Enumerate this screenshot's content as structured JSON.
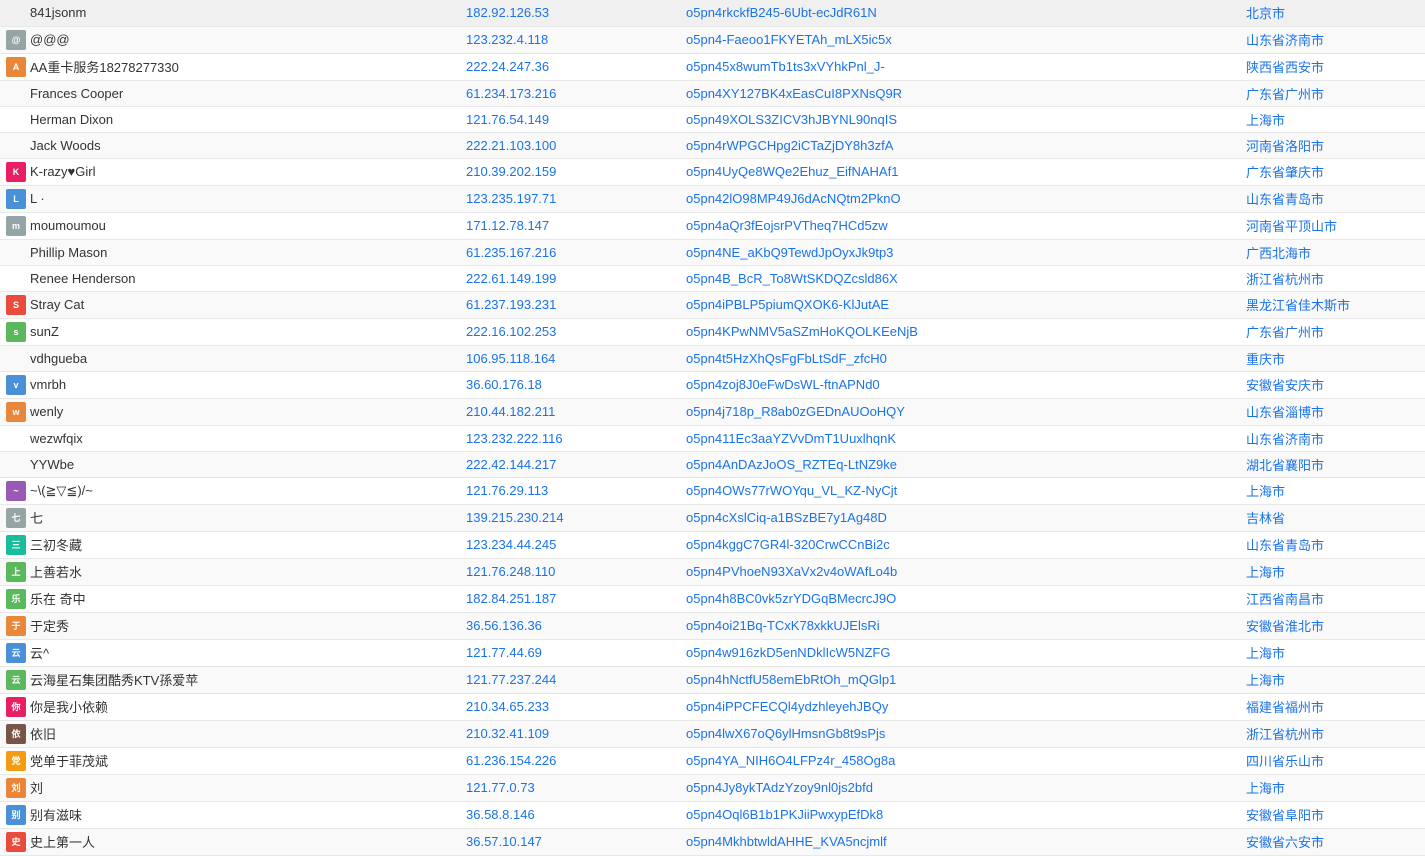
{
  "rows": [
    {
      "name": "841jsonm",
      "hasAvatar": false,
      "avatarColor": "",
      "nameStyle": "plain",
      "ip": "182.92.126.53",
      "id": "o5pn4rkckfB245-6Ubt-ecJdR61N",
      "location": "北京市"
    },
    {
      "name": "@@@",
      "hasAvatar": true,
      "avatarColor": "av-gray",
      "nameStyle": "plain",
      "ip": "123.232.4.118",
      "id": "o5pn4-Faeoo1FKYETAh_mLX5ic5x",
      "location": "山东省济南市"
    },
    {
      "name": "AA重卡服务18278277330",
      "hasAvatar": true,
      "avatarColor": "av-orange",
      "nameStyle": "plain",
      "ip": "222.24.247.36",
      "id": "o5pn45x8wumTb1ts3xVYhkPnl_J-",
      "location": "陕西省西安市"
    },
    {
      "name": "Frances Cooper",
      "hasAvatar": false,
      "avatarColor": "",
      "nameStyle": "plain",
      "ip": "61.234.173.216",
      "id": "o5pn4XY127BK4xEasCuI8PXNsQ9R",
      "location": "广东省广州市"
    },
    {
      "name": "Herman Dixon",
      "hasAvatar": false,
      "avatarColor": "",
      "nameStyle": "plain",
      "ip": "121.76.54.149",
      "id": "o5pn49XOLS3ZICV3hJBYNL90nqIS",
      "location": "上海市"
    },
    {
      "name": "Jack Woods",
      "hasAvatar": false,
      "avatarColor": "",
      "nameStyle": "plain",
      "ip": "222.21.103.100",
      "id": "o5pn4rWPGCHpg2iCTaZjDY8h3zfA",
      "location": "河南省洛阳市"
    },
    {
      "name": "K-razy♥Girl",
      "hasAvatar": true,
      "avatarColor": "av-pink",
      "nameStyle": "plain",
      "ip": "210.39.202.159",
      "id": "o5pn4UyQe8WQe2Ehuz_EifNAHAf1",
      "location": "广东省肇庆市"
    },
    {
      "name": "L ·",
      "hasAvatar": true,
      "avatarColor": "av-blue",
      "nameStyle": "plain",
      "ip": "123.235.197.71",
      "id": "o5pn42lO98MP49J6dAcNQtm2PknO",
      "location": "山东省青岛市"
    },
    {
      "name": "moumoumou",
      "hasAvatar": true,
      "avatarColor": "av-gray",
      "nameStyle": "plain",
      "ip": "171.12.78.147",
      "id": "o5pn4aQr3fEojsrPVTheq7HCd5zw",
      "location": "河南省平顶山市"
    },
    {
      "name": "Phillip Mason",
      "hasAvatar": false,
      "avatarColor": "",
      "nameStyle": "plain",
      "ip": "61.235.167.216",
      "id": "o5pn4NE_aKbQ9TewdJpOyxJk9tp3",
      "location": "广西北海市"
    },
    {
      "name": "Renee Henderson",
      "hasAvatar": false,
      "avatarColor": "",
      "nameStyle": "plain",
      "ip": "222.61.149.199",
      "id": "o5pn4B_BcR_To8WtSKDQZcsld86X",
      "location": "浙江省杭州市"
    },
    {
      "name": "Stray Cat",
      "hasAvatar": true,
      "avatarColor": "av-red",
      "nameStyle": "plain",
      "ip": "61.237.193.231",
      "id": "o5pn4iPBLP5piumQXOK6-KlJutAE",
      "location": "黑龙江省佳木斯市"
    },
    {
      "name": "sunZ",
      "hasAvatar": true,
      "avatarColor": "av-green",
      "nameStyle": "plain",
      "ip": "222.16.102.253",
      "id": "o5pn4KPwNMV5aSZmHoKQOLKEeNjB",
      "location": "广东省广州市"
    },
    {
      "name": "vdhgueba",
      "hasAvatar": false,
      "avatarColor": "",
      "nameStyle": "plain",
      "ip": "106.95.118.164",
      "id": "o5pn4t5HzXhQsFgFbLtSdF_zfcH0",
      "location": "重庆市"
    },
    {
      "name": "vmrbh",
      "hasAvatar": true,
      "avatarColor": "av-blue",
      "nameStyle": "plain",
      "ip": "36.60.176.18",
      "id": "o5pn4zoj8J0eFwDsWL-ftnAPNd0",
      "location": "安徽省安庆市"
    },
    {
      "name": "wenly",
      "hasAvatar": true,
      "avatarColor": "av-orange",
      "nameStyle": "plain",
      "ip": "210.44.182.211",
      "id": "o5pn4j718p_R8ab0zGEDnAUOoHQY",
      "location": "山东省淄博市"
    },
    {
      "name": "wezwfqix",
      "hasAvatar": false,
      "avatarColor": "",
      "nameStyle": "plain",
      "ip": "123.232.222.116",
      "id": "o5pn411Ec3aaYZVvDmT1UuxlhqnK",
      "location": "山东省济南市"
    },
    {
      "name": "YYWbe",
      "hasAvatar": false,
      "avatarColor": "",
      "nameStyle": "plain",
      "ip": "222.42.144.217",
      "id": "o5pn4AnDAzJoOS_RZTEq-LtNZ9ke",
      "location": "湖北省襄阳市"
    },
    {
      "name": "~\\(≧▽≦)/~",
      "hasAvatar": true,
      "avatarColor": "av-purple",
      "nameStyle": "plain",
      "ip": "121.76.29.113",
      "id": "o5pn4OWs77rWOYqu_VL_KZ-NyCjt",
      "location": "上海市"
    },
    {
      "name": "七",
      "hasAvatar": true,
      "avatarColor": "av-gray",
      "nameStyle": "plain",
      "ip": "139.215.230.214",
      "id": "o5pn4cXslCiq-a1BSzBE7y1Ag48D",
      "location": "吉林省"
    },
    {
      "name": "三初冬藏",
      "hasAvatar": true,
      "avatarColor": "av-teal",
      "nameStyle": "plain",
      "ip": "123.234.44.245",
      "id": "o5pn4kggC7GR4l-320CrwCCnBi2c",
      "location": "山东省青岛市"
    },
    {
      "name": "上善若水",
      "hasAvatar": true,
      "avatarColor": "av-green",
      "nameStyle": "plain",
      "ip": "121.76.248.110",
      "id": "o5pn4PVhoeN93XaVx2v4oWAfLo4b",
      "location": "上海市"
    },
    {
      "name": "乐在 奇中",
      "hasAvatar": true,
      "avatarColor": "av-green",
      "nameStyle": "plain",
      "ip": "182.84.251.187",
      "id": "o5pn4h8BC0vk5zrYDGqBMecrcJ9O",
      "location": "江西省南昌市"
    },
    {
      "name": "于定秀",
      "hasAvatar": true,
      "avatarColor": "av-orange",
      "nameStyle": "plain",
      "ip": "36.56.136.36",
      "id": "o5pn4oi21Bq-TCxK78xkkUJElsRi",
      "location": "安徽省淮北市"
    },
    {
      "name": "云^",
      "hasAvatar": true,
      "avatarColor": "av-blue",
      "nameStyle": "plain",
      "ip": "121.77.44.69",
      "id": "o5pn4w916zkD5enNDklIcW5NZFG",
      "location": "上海市"
    },
    {
      "name": "云海星石集团酷秀KTV孫爱苹",
      "hasAvatar": true,
      "avatarColor": "av-green",
      "nameStyle": "plain",
      "ip": "121.77.237.244",
      "id": "o5pn4hNctfU58emEbRtOh_mQGlp1",
      "location": "上海市"
    },
    {
      "name": "你是我小依赖",
      "hasAvatar": true,
      "avatarColor": "av-pink",
      "nameStyle": "plain",
      "ip": "210.34.65.233",
      "id": "o5pn4iPPCFECQl4ydzhleyehJBQy",
      "location": "福建省福州市"
    },
    {
      "name": "依旧",
      "hasAvatar": true,
      "avatarColor": "av-brown",
      "nameStyle": "plain",
      "ip": "210.32.41.109",
      "id": "o5pn4lwX67oQ6ylHmsnGb8t9sPjs",
      "location": "浙江省杭州市"
    },
    {
      "name": "党单于菲茂斌",
      "hasAvatar": true,
      "avatarColor": "av-yellow",
      "nameStyle": "plain",
      "ip": "61.236.154.226",
      "id": "o5pn4YA_NIH6O4LFPz4r_458Og8a",
      "location": "四川省乐山市"
    },
    {
      "name": "刘",
      "hasAvatar": true,
      "avatarColor": "av-orange",
      "nameStyle": "plain",
      "ip": "121.77.0.73",
      "id": "o5pn4Jy8ykTAdzYzoy9nl0js2bfd",
      "location": "上海市"
    },
    {
      "name": "别有滋味",
      "hasAvatar": true,
      "avatarColor": "av-blue",
      "nameStyle": "plain",
      "ip": "36.58.8.146",
      "id": "o5pn4Oql6B1b1PKJiiPwxypEfDk8",
      "location": "安徽省阜阳市"
    },
    {
      "name": "史上第一人",
      "hasAvatar": true,
      "avatarColor": "av-red",
      "nameStyle": "plain",
      "ip": "36.57.10.147",
      "id": "o5pn4MkhbtwldAHHE_KVA5ncjmlf",
      "location": "安徽省六安市"
    }
  ]
}
